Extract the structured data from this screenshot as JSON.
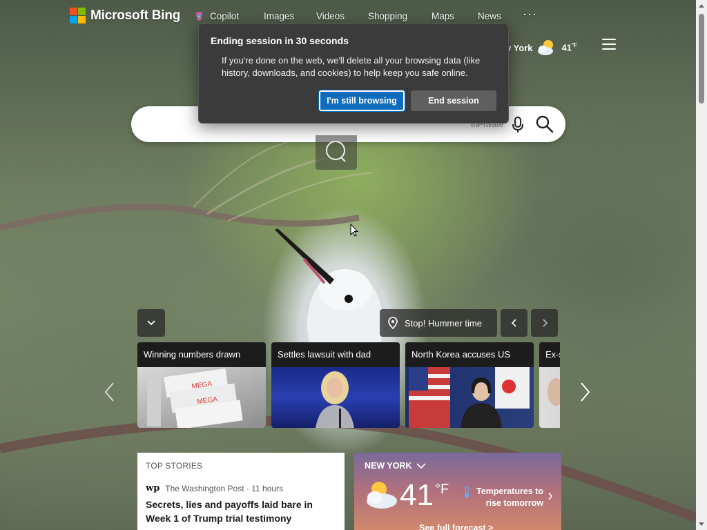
{
  "brand": {
    "name": "Microsoft Bing",
    "tile_colors": [
      "#f25022",
      "#7fba00",
      "#00a4ef",
      "#ffb900"
    ]
  },
  "nav": {
    "copilot": "Copilot",
    "images": "Images",
    "videos": "Videos",
    "shopping": "Shopping",
    "maps": "Maps",
    "news": "News",
    "more": "···"
  },
  "header_weather": {
    "city": "w York",
    "temp": "41",
    "unit": "°F",
    "icon": "partly-cloudy-icon"
  },
  "search": {
    "inprivate_label": "InPrivate",
    "value": ""
  },
  "dialog": {
    "title": "Ending session in 30 seconds",
    "body": "If you're done on the web, we'll delete all your browsing data (like history, downloads, and cookies) to help keep you safe online.",
    "primary_label": "I'm still browsing",
    "secondary_label": "End session"
  },
  "image_info": {
    "title": "Stop! Hummer time"
  },
  "news_cards": [
    {
      "title": "Winning numbers drawn",
      "image": "lottery-tickets"
    },
    {
      "title": "Settles lawsuit with dad",
      "image": "performer-on-stage"
    },
    {
      "title": "North Korea accuses US",
      "image": "speaker-with-flags"
    },
    {
      "title": "Ex-s",
      "image": "portrait"
    }
  ],
  "top_stories": {
    "label": "TOP STORIES",
    "source_logo": "wp",
    "source": "The Washington Post · 11 hours",
    "headline": "Secrets, lies and payoffs laid bare in Week 1 of Trump trial testimony"
  },
  "weather_card": {
    "city": "NEW YORK",
    "temp": "41",
    "unit": "°F",
    "trend": "Temperatures to rise tomorrow",
    "forecast_link": "See full forecast >"
  },
  "colors": {
    "accent": "#0f6cbd",
    "dialog_bg": "#3b3b3b"
  }
}
